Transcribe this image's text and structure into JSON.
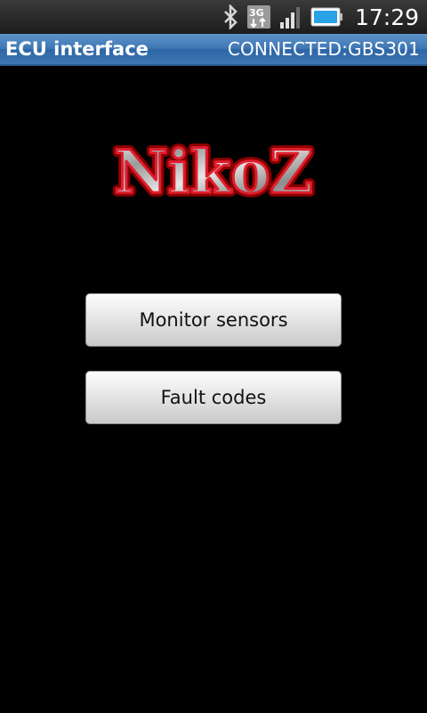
{
  "status_bar": {
    "time": "17:29",
    "icons": [
      "bluetooth-icon",
      "3g-data-icon",
      "signal-strength-icon",
      "battery-icon"
    ],
    "network_label": "3G"
  },
  "title_bar": {
    "app_title": "ECU interface",
    "connection_status": "CONNECTED:GBS301",
    "background_color": "#3f77b5"
  },
  "logo": {
    "text": "NikoZ",
    "outline_color": "#c8102e",
    "fill_color": "#c8c8c8"
  },
  "buttons": {
    "monitor_sensors": "Monitor sensors",
    "fault_codes": "Fault codes"
  }
}
